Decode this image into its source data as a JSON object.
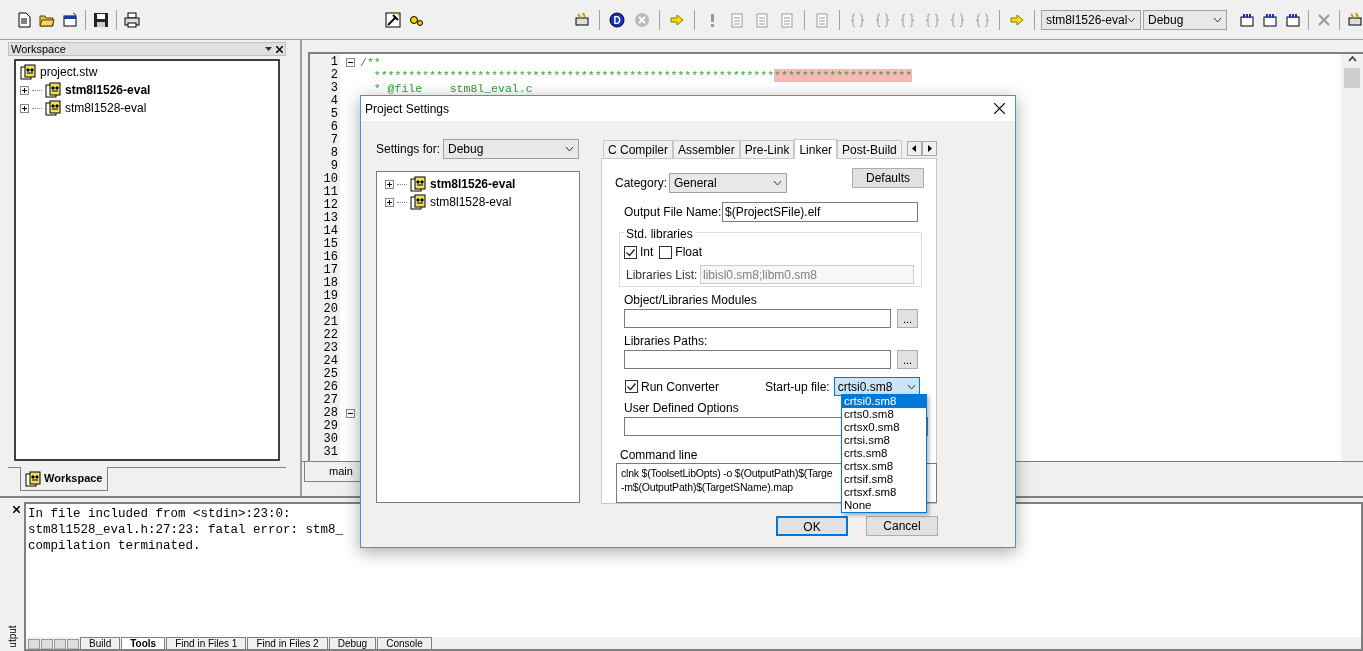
{
  "toolbar": {
    "debug_icon_letter": "D",
    "target_combo": "stm8l1526-eval",
    "config_combo": "Debug"
  },
  "workspace": {
    "title": "Workspace",
    "tree": [
      {
        "label": "project.stw",
        "active": false,
        "children": [
          {
            "label": "stm8l1526-eval",
            "active": true
          },
          {
            "label": "stm8l1528-eval",
            "active": false
          }
        ]
      }
    ],
    "tab": "Workspace"
  },
  "editor": {
    "lines": [
      {
        "number": "1",
        "text": "/**"
      },
      {
        "number": "2",
        "text": "  **********************************************************",
        "highlight": "********************"
      },
      {
        "number": "3",
        "text": "  * @file    stm8l_eval.c"
      },
      {
        "number": "4"
      },
      {
        "number": "5"
      },
      {
        "number": "6"
      },
      {
        "number": "7"
      },
      {
        "number": "8"
      },
      {
        "number": "9"
      },
      {
        "number": "10"
      },
      {
        "number": "11"
      },
      {
        "number": "12"
      },
      {
        "number": "13"
      },
      {
        "number": "14"
      },
      {
        "number": "15"
      },
      {
        "number": "16"
      },
      {
        "number": "17"
      },
      {
        "number": "18"
      },
      {
        "number": "19"
      },
      {
        "number": "20"
      },
      {
        "number": "21"
      },
      {
        "number": "22"
      },
      {
        "number": "23"
      },
      {
        "number": "24"
      },
      {
        "number": "25"
      },
      {
        "number": "26"
      },
      {
        "number": "27"
      },
      {
        "number": "28"
      },
      {
        "number": "29"
      },
      {
        "number": "30"
      },
      {
        "number": "31"
      }
    ],
    "tabs": [
      {
        "label": "main",
        "selected": true
      }
    ]
  },
  "output": {
    "side_label": "utput",
    "lines": [
      "In file included from <stdin>:23:0:",
      "stm8l1528_eval.h:27:23: fatal error: stm8_",
      "compilation terminated."
    ],
    "tabs": [
      {
        "label": "Build",
        "selected": false
      },
      {
        "label": "Tools",
        "selected": true
      },
      {
        "label": "Find in Files 1",
        "selected": false
      },
      {
        "label": "Find in Files 2",
        "selected": false
      },
      {
        "label": "Debug",
        "selected": false
      },
      {
        "label": "Console",
        "selected": false
      }
    ]
  },
  "dialog": {
    "title": "Project Settings",
    "settings_for_label": "Settings for:",
    "settings_for_value": "Debug",
    "tree": [
      {
        "label": "stm8l1526-eval",
        "active": true
      },
      {
        "label": "stm8l1528-eval",
        "active": false
      }
    ],
    "tabs": [
      {
        "label": "C Compiler",
        "selected": false
      },
      {
        "label": "Assembler",
        "selected": false
      },
      {
        "label": "Pre-Link",
        "selected": false
      },
      {
        "label": "Linker",
        "selected": true
      },
      {
        "label": "Post-Build",
        "selected": false
      }
    ],
    "category_label": "Category:",
    "category_value": "General",
    "defaults_button": "Defaults",
    "output_file_label": "Output File Name:",
    "output_file_value": "$(ProjectSFile).elf",
    "std_libraries": {
      "title": "Std. libraries",
      "checkboxes": [
        {
          "label": "Int",
          "checked": true
        },
        {
          "label": "Float",
          "checked": false
        }
      ],
      "list_label": "Libraries List:",
      "list_value": "libisl0.sm8;libm0.sm8"
    },
    "modules_label": "Object/Libraries Modules",
    "browse_button": "...",
    "paths_label": "Libraries Paths:",
    "paths_browse_button": "...",
    "run_converter": {
      "label": "Run Converter",
      "checked": true
    },
    "startup_label": "Start-up file:",
    "startup_value": "crtsi0.sm8",
    "startup_options": [
      {
        "label": "crtsi0.sm8",
        "selected": true
      },
      {
        "label": "crts0.sm8",
        "selected": false
      },
      {
        "label": "crtsx0.sm8",
        "selected": false
      },
      {
        "label": "crtsi.sm8",
        "selected": false
      },
      {
        "label": "crts.sm8",
        "selected": false
      },
      {
        "label": "crtsx.sm8",
        "selected": false
      },
      {
        "label": "crtsif.sm8",
        "selected": false
      },
      {
        "label": "crtsxf.sm8",
        "selected": false
      },
      {
        "label": "None",
        "selected": false
      }
    ],
    "user_options_label": "User Defined Options",
    "command_line_label": "Command line",
    "command_line": [
      "clnk $(ToolsetLibOpts) -o $(OutputPath)$(Targe",
      "-m$(OutputPath)$(TargetSName).map"
    ],
    "ok_button": "OK",
    "cancel_button": "Cancel"
  }
}
